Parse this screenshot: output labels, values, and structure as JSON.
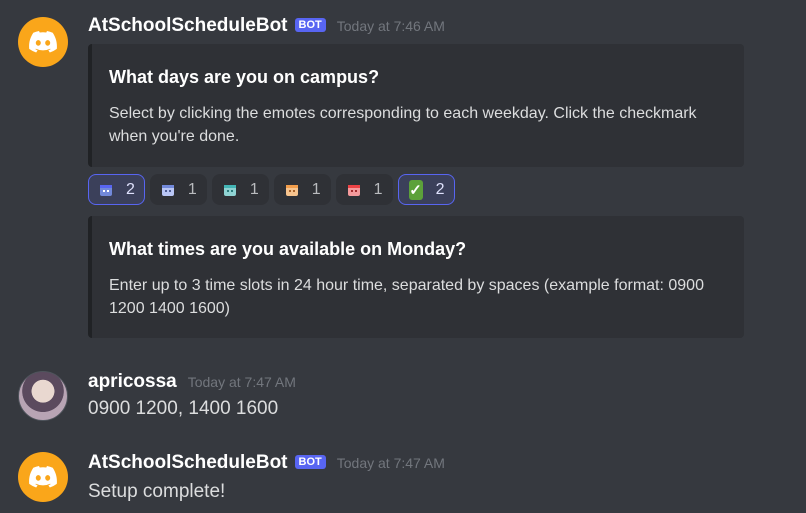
{
  "messages": [
    {
      "author": "AtSchoolScheduleBot",
      "badge": "BOT",
      "timestamp": "Today at 7:46 AM",
      "embeds": [
        {
          "title": "What days are you on campus?",
          "description": "Select by clicking the emotes corresponding to each weekday. Click the checkmark when you're done."
        },
        {
          "title": "What times are you available on Monday?",
          "description": "Enter up to 3 time slots in 24 hour time, separated by spaces (example format: 0900 1200 1400 1600)"
        }
      ],
      "reactions": [
        {
          "emote": "calendar-purple-icon",
          "color": "#7289da",
          "count": "2",
          "reacted": true
        },
        {
          "emote": "calendar-blue-icon",
          "color": "#99aab5",
          "count": "1",
          "reacted": false
        },
        {
          "emote": "calendar-teal-icon",
          "color": "#43b5b5",
          "count": "1",
          "reacted": false
        },
        {
          "emote": "calendar-orange-icon",
          "color": "#f29d4b",
          "count": "1",
          "reacted": false
        },
        {
          "emote": "calendar-red-icon",
          "color": "#ed4245",
          "count": "1",
          "reacted": false
        },
        {
          "emote": "check-mark-icon",
          "color": "#5ca13a",
          "count": "2",
          "reacted": true
        }
      ]
    },
    {
      "author": "apricossa",
      "timestamp": "Today at 7:47 AM",
      "content": "0900 1200, 1400 1600"
    },
    {
      "author": "AtSchoolScheduleBot",
      "badge": "BOT",
      "timestamp": "Today at 7:47 AM",
      "content": "Setup complete!"
    }
  ]
}
